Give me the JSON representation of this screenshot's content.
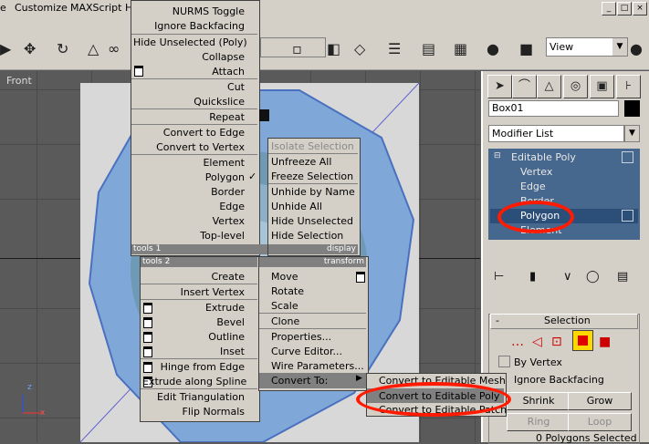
{
  "menubar": {
    "items": [
      "Customize",
      "MAXScript",
      "H"
    ],
    "win_buttons": [
      "_",
      "□",
      "×"
    ]
  },
  "toolbar": {
    "view_dropdown": "View"
  },
  "viewport": {
    "label": "Front",
    "axis_x": "x",
    "axis_z": "z"
  },
  "command_panel": {
    "object_name": "Box01",
    "modifier_list": "Modifier List",
    "stack": {
      "root": "Editable Poly",
      "subobjects": [
        "Vertex",
        "Edge",
        "Border",
        "Polygon",
        "Element"
      ],
      "selected": "Polygon"
    },
    "selection_rollout": {
      "title": "Selection",
      "by_vertex": "By Vertex",
      "ignore_backfacing": "Ignore Backfacing",
      "shrink": "Shrink",
      "grow": "Grow",
      "ring": "Ring",
      "loop": "Loop",
      "status": "0 Polygons Selected"
    }
  },
  "quad_menu": {
    "top_left": {
      "items": [
        "NURMS Toggle",
        "Ignore Backfacing",
        "Hide Unselected (Poly)",
        "Collapse",
        "Attach",
        "Cut",
        "Quickslice",
        "Repeat",
        "Convert to Edge",
        "Convert to Vertex",
        "Element",
        "Polygon",
        "Border",
        "Edge",
        "Vertex",
        "Top-level"
      ],
      "checked": "Polygon",
      "header": "tools 1"
    },
    "top_right": {
      "items": [
        "Isolate Selection",
        "Unfreeze All",
        "Freeze Selection",
        "Unhide by Name",
        "Unhide All",
        "Hide Unselected",
        "Hide Selection"
      ],
      "header": "display"
    },
    "bottom_left": {
      "header": "tools 2",
      "items": [
        "Create",
        "Insert Vertex",
        "Extrude",
        "Bevel",
        "Outline",
        "Inset",
        "Hinge from Edge",
        "Extrude along Spline",
        "Edit Triangulation",
        "Flip Normals"
      ]
    },
    "bottom_right": {
      "header": "transform",
      "items": [
        "Move",
        "Rotate",
        "Scale",
        "Clone",
        "Properties...",
        "Curve Editor...",
        "Wire Parameters...",
        "Convert To:"
      ]
    },
    "submenu": {
      "items": [
        "Convert to Editable Mesh",
        "Convert to Editable Poly",
        "Convert to Editable Patch"
      ],
      "highlighted": "Convert to Editable Poly"
    }
  }
}
